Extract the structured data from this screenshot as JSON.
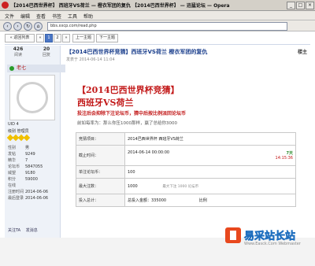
{
  "window": {
    "title": "【2014巴西世界杯】 西班牙VS荷兰 — 橙衣军团的复仇 【2014巴西世界杯】 — 迅猛论坛 — Opera",
    "browser_label": "Opera"
  },
  "menu": [
    "文件",
    "编辑",
    "查看",
    "书签",
    "工具",
    "帮助"
  ],
  "address": {
    "url": "bbs.xxcp.com/read.php"
  },
  "pager": {
    "first": "« 返回列表",
    "prev": "«",
    "pages": [
      "1",
      "2"
    ],
    "current": "1",
    "next": "»",
    "prev_topic": "上一主题",
    "next_topic": "下一主题"
  },
  "user": {
    "views": "426",
    "views_label": "阅读",
    "replies": "20",
    "replies_label": "回复",
    "name": "老七",
    "uid": "UID 4",
    "group": "级别 管理员",
    "fields": [
      {
        "k": "性别",
        "v": "男"
      },
      {
        "k": "发帖",
        "v": "9249"
      },
      {
        "k": "精华",
        "v": "7"
      },
      {
        "k": "论坛币",
        "v": "5847055"
      },
      {
        "k": "威望",
        "v": "9180"
      },
      {
        "k": "积分",
        "v": "59000"
      },
      {
        "k": "在线",
        "v": ""
      },
      {
        "k": "注册时间",
        "v": "2014-06-06"
      },
      {
        "k": "最后登录",
        "v": "2014-06-06"
      }
    ],
    "actions": [
      "关注TA",
      "发消息"
    ]
  },
  "post": {
    "title": "【2014巴西世界杯竞猜】西班牙VS荷兰    橙衣军团的复仇",
    "meta": "发表于 2014-06-14 11:04",
    "floor": "楼主",
    "headline1": "【2014巴西世界杯竞猜】",
    "headline2": "西班牙VS荷兰",
    "headline3": "投注后会抑除下注论坛币，猜中后按比例派回论坛币",
    "headline4": "前如每率为：那么你压1000那样，赢了总给你3000",
    "table": {
      "row1_label": "竞猜项目：",
      "row1_value": "2014巴西世界杯 西班牙VS荷兰",
      "row2_label": "截止时间：",
      "row2_value": "2014-06-14 00:00:00",
      "row2_days": "7天",
      "row2_time": "14:15:36",
      "row3_label": "单注论坛币：",
      "row3_value": "100",
      "row4_label": "最大注数：",
      "row4_value": "1000",
      "row4_note": "最大下注 1000 论坛币",
      "row5_label": "投入总计：",
      "row5_value": "总投入金额：335000",
      "row5_extra": "比例"
    }
  },
  "watermark": {
    "brand": "易采站长站",
    "url": "Www.Easck.Com Webmaster"
  },
  "colors": {
    "headline": "#c21818",
    "link": "#1a3e8c",
    "brand": "#e8481e"
  }
}
